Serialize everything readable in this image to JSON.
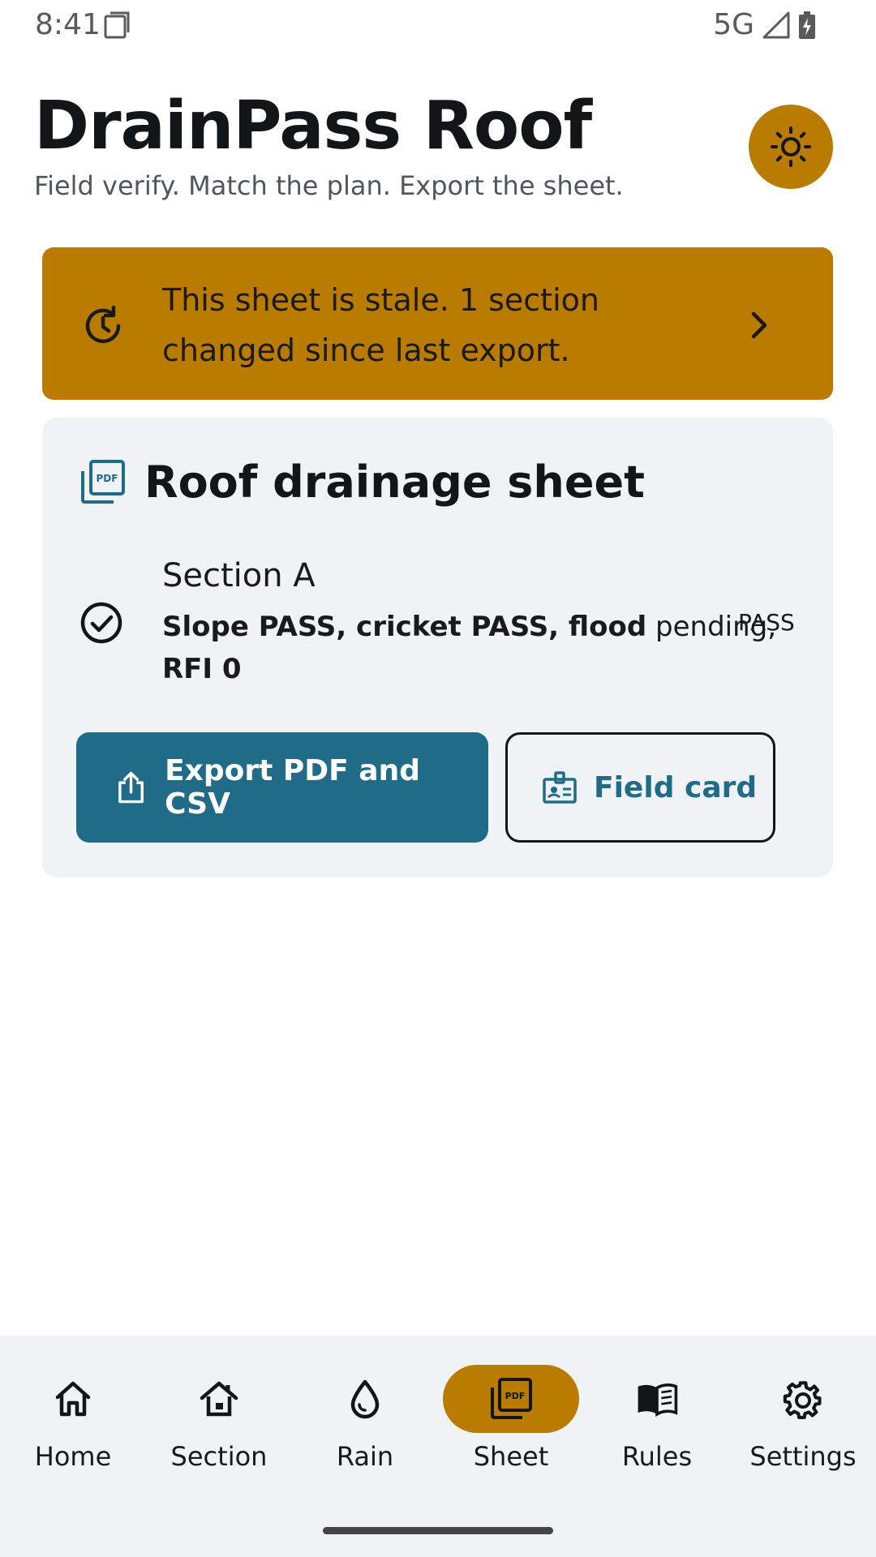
{
  "status_bar": {
    "time": "8:41",
    "network": "5G"
  },
  "header": {
    "title": "DrainPass Roof",
    "subtitle": "Field verify. Match the plan. Export the sheet.",
    "theme_icon": "sun-icon"
  },
  "stale_banner": {
    "text": "This sheet is stale. 1 section changed since last export.",
    "icon": "history-icon"
  },
  "sheet_card": {
    "title": "Roof drainage sheet",
    "section": {
      "name": "Section A",
      "detail_bold": "Slope PASS, cricket PASS, flood",
      "detail_pending": "pending,",
      "badge": "PASS",
      "rfi": "RFI 0"
    },
    "export_label": "Export PDF and CSV",
    "field_card_label": "Field card"
  },
  "nav": {
    "items": [
      {
        "label": "Home",
        "icon": "home-icon"
      },
      {
        "label": "Section",
        "icon": "section-icon"
      },
      {
        "label": "Rain",
        "icon": "rain-drop-icon"
      },
      {
        "label": "Sheet",
        "icon": "pdf-icon"
      },
      {
        "label": "Rules",
        "icon": "book-icon"
      },
      {
        "label": "Settings",
        "icon": "gear-icon"
      }
    ],
    "active": "Sheet"
  },
  "colors": {
    "accent": "#b97c00",
    "primary": "#206b87",
    "surface": "#f0f3f6"
  }
}
